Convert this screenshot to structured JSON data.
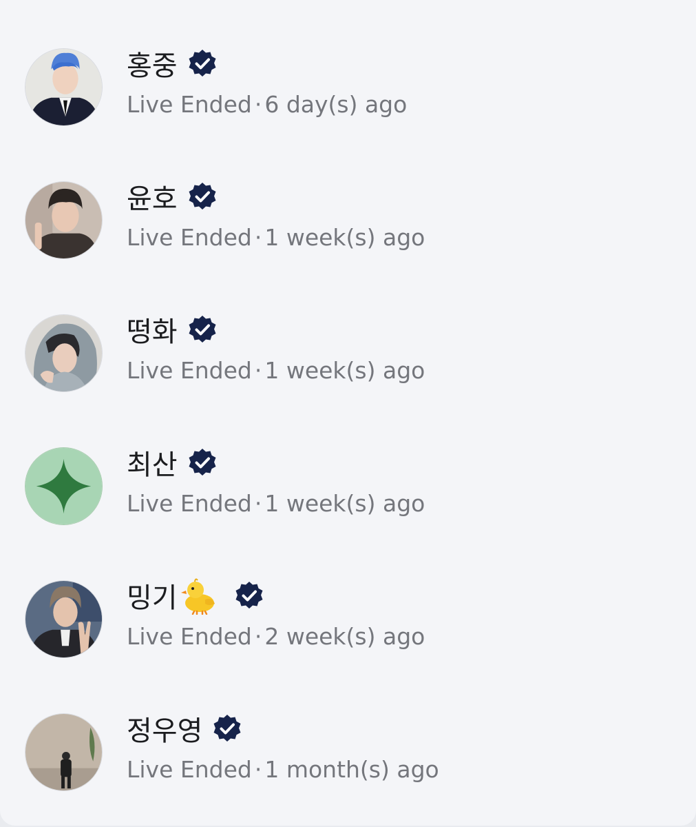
{
  "accent_color": "#16234a",
  "status_color": "#74767c",
  "list": {
    "items": [
      {
        "name": "홍중",
        "status": "Live Ended",
        "time": "6 day(s) ago",
        "emoji_icon": null
      },
      {
        "name": "윤호",
        "status": "Live Ended",
        "time": "1 week(s) ago",
        "emoji_icon": null
      },
      {
        "name": "떵화",
        "status": "Live Ended",
        "time": "1 week(s) ago",
        "emoji_icon": null
      },
      {
        "name": "최산",
        "status": "Live Ended",
        "time": "1 week(s) ago",
        "emoji_icon": null
      },
      {
        "name": "밍기",
        "status": "Live Ended",
        "time": "2 week(s) ago",
        "emoji_icon": "baby-chick-icon"
      },
      {
        "name": "정우영",
        "status": "Live Ended",
        "time": "1 month(s) ago",
        "emoji_icon": null
      }
    ],
    "separator": "·"
  }
}
